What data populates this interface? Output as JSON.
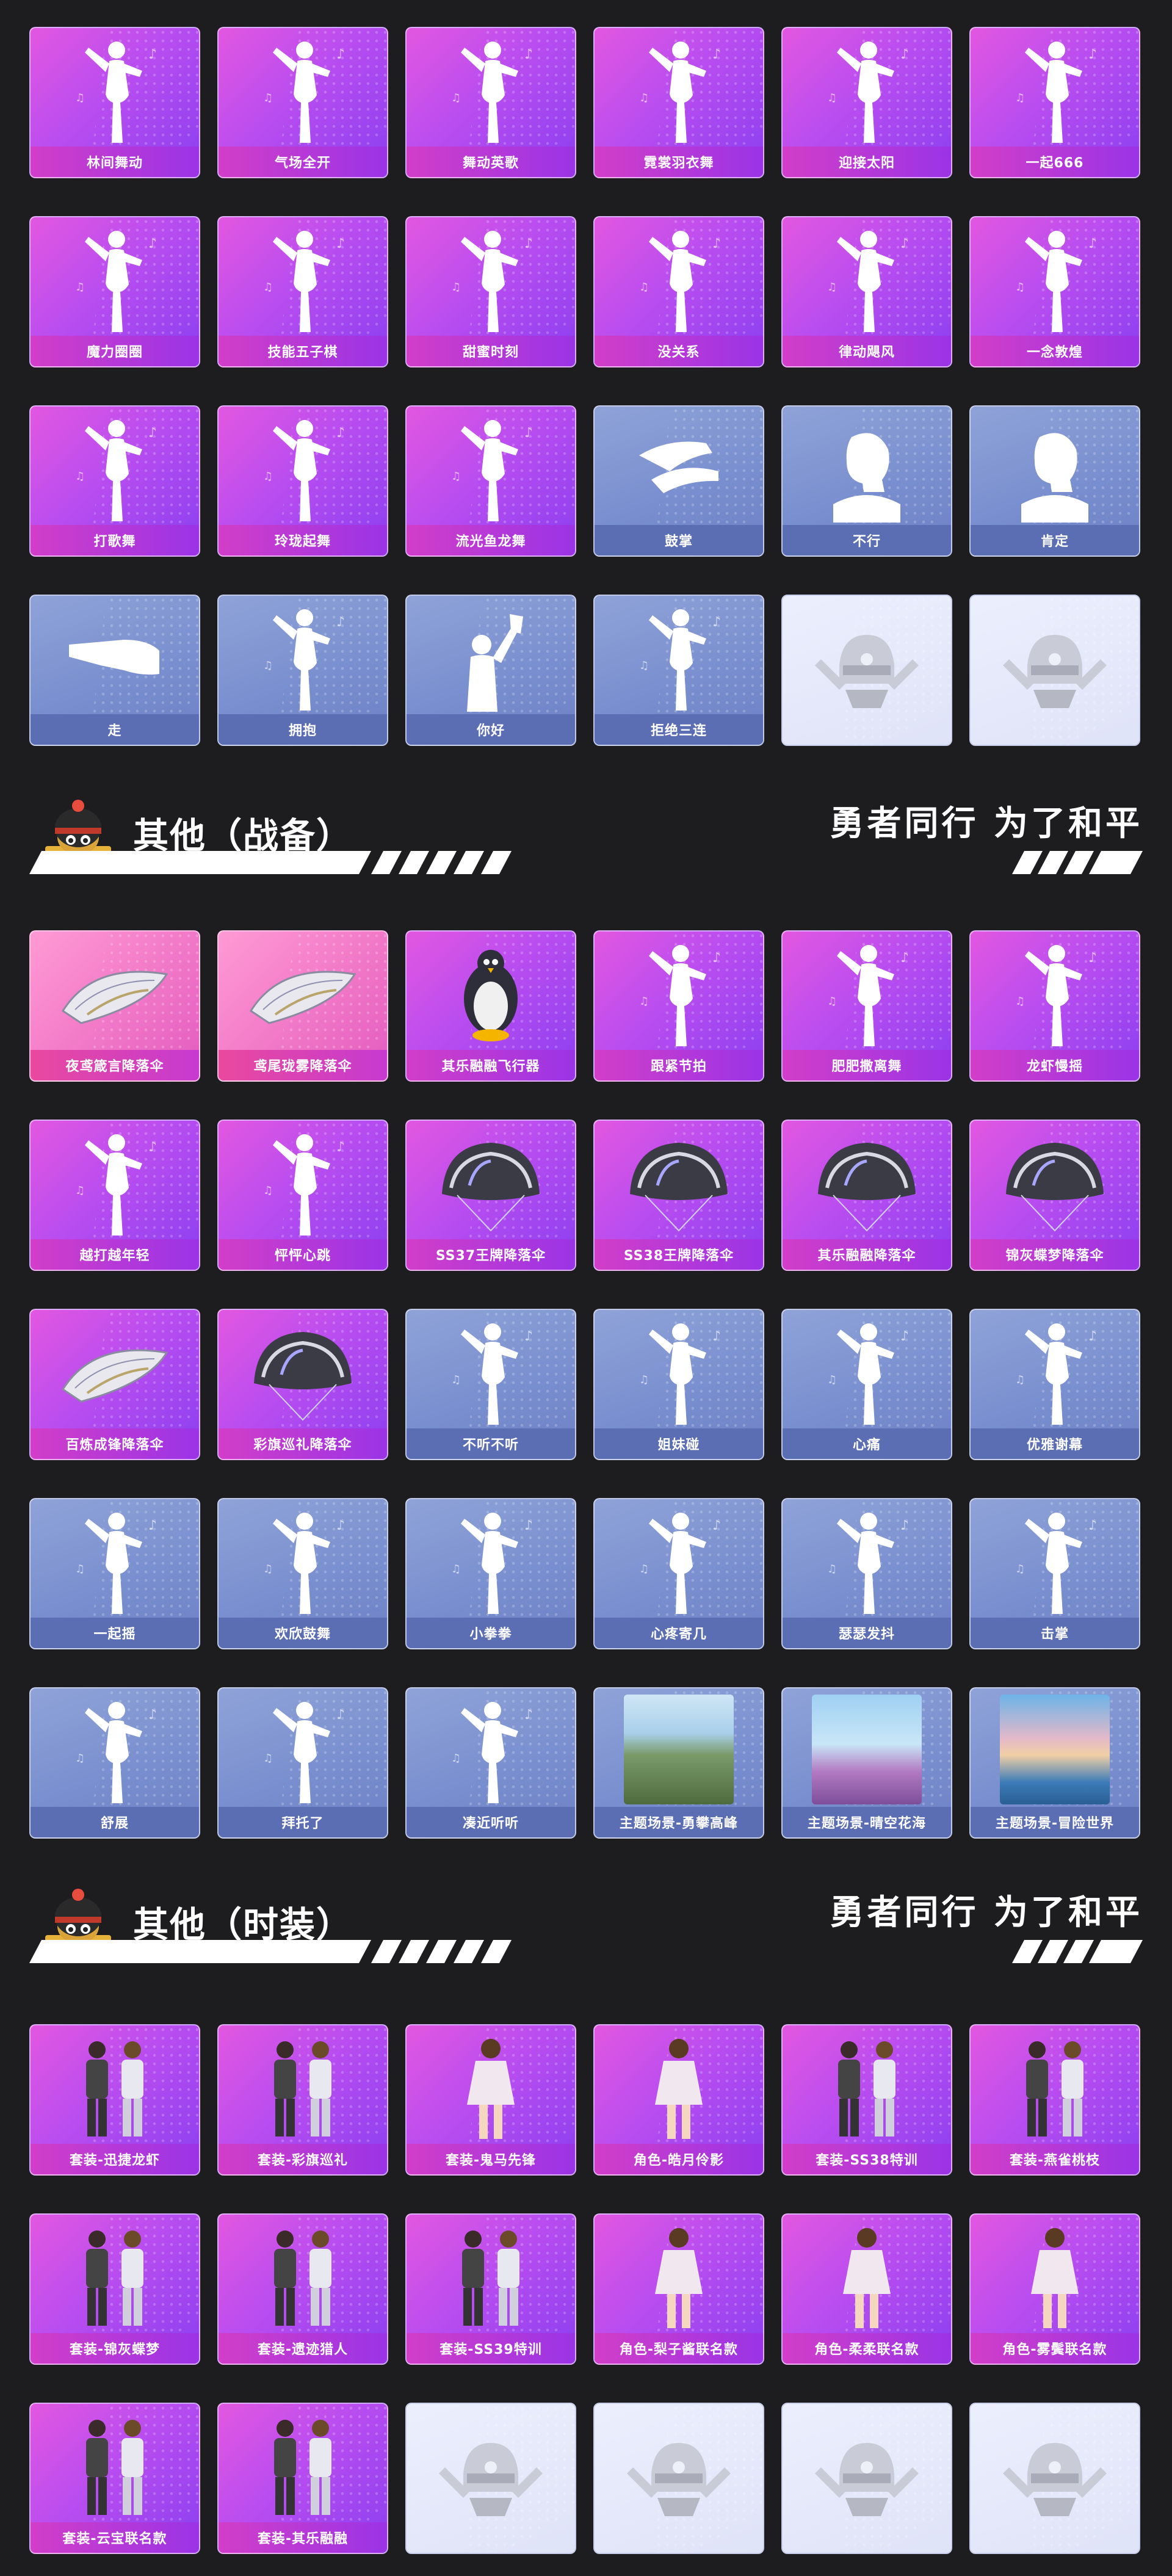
{
  "section1": {
    "tiles": [
      {
        "label": "林间舞动",
        "style": "purple",
        "art": "dancer-icon"
      },
      {
        "label": "气场全开",
        "style": "purple",
        "art": "dancer-icon"
      },
      {
        "label": "舞动英歌",
        "style": "purple",
        "art": "dancer-icon"
      },
      {
        "label": "霓裳羽衣舞",
        "style": "purple",
        "art": "dancer-icon"
      },
      {
        "label": "迎接太阳",
        "style": "purple",
        "art": "dancer-icon"
      },
      {
        "label": "一起666",
        "style": "purple",
        "art": "dancer-icon"
      },
      {
        "label": "魔力圈圈",
        "style": "purple",
        "art": "dancer-icon"
      },
      {
        "label": "技能五子棋",
        "style": "purple",
        "art": "dancer-icon"
      },
      {
        "label": "甜蜜时刻",
        "style": "purple",
        "art": "dancer-icon"
      },
      {
        "label": "没关系",
        "style": "purple",
        "art": "dancer-icon"
      },
      {
        "label": "律动飓风",
        "style": "purple",
        "art": "dancer-icon"
      },
      {
        "label": "一念敦煌",
        "style": "purple",
        "art": "dancer-icon"
      },
      {
        "label": "打歌舞",
        "style": "purple",
        "art": "dancer-icon"
      },
      {
        "label": "玲珑起舞",
        "style": "purple",
        "art": "dancer-icon"
      },
      {
        "label": "流光鱼龙舞",
        "style": "purple",
        "art": "dancer-icon"
      },
      {
        "label": "鼓掌",
        "style": "blue",
        "art": "clap-icon"
      },
      {
        "label": "不行",
        "style": "blue",
        "art": "head-icon"
      },
      {
        "label": "肯定",
        "style": "blue",
        "art": "head-icon"
      },
      {
        "label": "走",
        "style": "blue",
        "art": "point-hand-icon"
      },
      {
        "label": "拥抱",
        "style": "blue",
        "art": "dancer-icon"
      },
      {
        "label": "你好",
        "style": "blue",
        "art": "wave-icon"
      },
      {
        "label": "拒绝三连",
        "style": "blue",
        "art": "dancer-icon"
      },
      {
        "label": "",
        "style": "empty",
        "art": "helmet-emblem-icon"
      },
      {
        "label": "",
        "style": "empty",
        "art": "helmet-emblem-icon"
      }
    ]
  },
  "section2": {
    "title": "其他（战备）",
    "slogan": "勇者同行 为了和平",
    "tiles": [
      {
        "label": "夜鸢箴言降落伞",
        "style": "pink",
        "art": "glider-icon"
      },
      {
        "label": "鸢尾珑雾降落伞",
        "style": "pink",
        "art": "glider-icon"
      },
      {
        "label": "其乐融融飞行器",
        "style": "purple",
        "art": "penguin-icon"
      },
      {
        "label": "跟紧节拍",
        "style": "purple",
        "art": "dancer-icon"
      },
      {
        "label": "肥肥撒离舞",
        "style": "purple",
        "art": "dancer-icon"
      },
      {
        "label": "龙虾慢摇",
        "style": "purple",
        "art": "dancer-icon"
      },
      {
        "label": "越打越年轻",
        "style": "purple",
        "art": "dancer-icon"
      },
      {
        "label": "怦怦心跳",
        "style": "purple",
        "art": "dancer-icon"
      },
      {
        "label": "SS37王牌降落伞",
        "style": "purple",
        "art": "parachute-icon"
      },
      {
        "label": "SS38王牌降落伞",
        "style": "purple",
        "art": "parachute-icon"
      },
      {
        "label": "其乐融融降落伞",
        "style": "purple",
        "art": "parachute-icon"
      },
      {
        "label": "锦灰蝶梦降落伞",
        "style": "purple",
        "art": "parachute-icon"
      },
      {
        "label": "百炼成锋降落伞",
        "style": "purple",
        "art": "glider-icon"
      },
      {
        "label": "彩旗巡礼降落伞",
        "style": "purple",
        "art": "parachute-icon"
      },
      {
        "label": "不听不听",
        "style": "blue",
        "art": "dancer-icon"
      },
      {
        "label": "姐妹碰",
        "style": "blue",
        "art": "dancer-icon"
      },
      {
        "label": "心痛",
        "style": "blue",
        "art": "dancer-icon"
      },
      {
        "label": "优雅谢幕",
        "style": "blue",
        "art": "dancer-icon"
      },
      {
        "label": "一起摇",
        "style": "blue",
        "art": "dancer-icon"
      },
      {
        "label": "欢欣鼓舞",
        "style": "blue",
        "art": "dancer-icon"
      },
      {
        "label": "小拳拳",
        "style": "blue",
        "art": "dancer-icon"
      },
      {
        "label": "心疼寄几",
        "style": "blue",
        "art": "dancer-icon"
      },
      {
        "label": "瑟瑟发抖",
        "style": "blue",
        "art": "dancer-icon"
      },
      {
        "label": "击掌",
        "style": "blue",
        "art": "dancer-icon"
      },
      {
        "label": "舒展",
        "style": "blue",
        "art": "dancer-icon"
      },
      {
        "label": "拜托了",
        "style": "blue",
        "art": "dancer-icon"
      },
      {
        "label": "凑近听听",
        "style": "blue",
        "art": "dancer-icon"
      },
      {
        "label": "主题场景-勇攀高峰",
        "style": "blue",
        "art": "scene-mountain"
      },
      {
        "label": "主题场景-晴空花海",
        "style": "blue",
        "art": "scene-flowers"
      },
      {
        "label": "主题场景-冒险世界",
        "style": "blue",
        "art": "scene-ocean"
      }
    ]
  },
  "section3": {
    "title": "其他（时装）",
    "slogan": "勇者同行 为了和平",
    "tiles": [
      {
        "label": "套装-迅捷龙虾",
        "style": "purple",
        "art": "outfit-pair-icon"
      },
      {
        "label": "套装-彩旗巡礼",
        "style": "purple",
        "art": "outfit-pair-icon"
      },
      {
        "label": "套装-鬼马先锋",
        "style": "purple",
        "art": "outfit-single-icon"
      },
      {
        "label": "角色-皓月伶影",
        "style": "purple",
        "art": "outfit-single-icon"
      },
      {
        "label": "套装-SS38特训",
        "style": "purple",
        "art": "outfit-pair-icon"
      },
      {
        "label": "套装-燕雀桃枝",
        "style": "purple",
        "art": "outfit-pair-icon"
      },
      {
        "label": "套装-锦灰蝶梦",
        "style": "purple",
        "art": "outfit-pair-icon"
      },
      {
        "label": "套装-遗迹猎人",
        "style": "purple",
        "art": "outfit-pair-icon"
      },
      {
        "label": "套装-SS39特训",
        "style": "purple",
        "art": "outfit-pair-icon"
      },
      {
        "label": "角色-梨子酱联名款",
        "style": "purple",
        "art": "outfit-single-icon"
      },
      {
        "label": "角色-柔柔联名款",
        "style": "purple",
        "art": "outfit-single-icon"
      },
      {
        "label": "角色-雾鬓联名款",
        "style": "purple",
        "art": "outfit-single-icon"
      },
      {
        "label": "套装-云宝联名款",
        "style": "purple",
        "art": "outfit-pair-icon"
      },
      {
        "label": "套装-其乐融融",
        "style": "purple",
        "art": "outfit-pair-icon"
      },
      {
        "label": "",
        "style": "empty",
        "art": "helmet-emblem-icon"
      },
      {
        "label": "",
        "style": "empty",
        "art": "helmet-emblem-icon"
      },
      {
        "label": "",
        "style": "empty",
        "art": "helmet-emblem-icon"
      },
      {
        "label": "",
        "style": "empty",
        "art": "helmet-emblem-icon"
      }
    ]
  },
  "colors": {
    "background": "#1d1d20",
    "purple_tile": "#b94df0",
    "pink_tile": "#f27ac8",
    "blue_tile": "#7a8fcf",
    "empty_tile": "#e4e8fa"
  }
}
